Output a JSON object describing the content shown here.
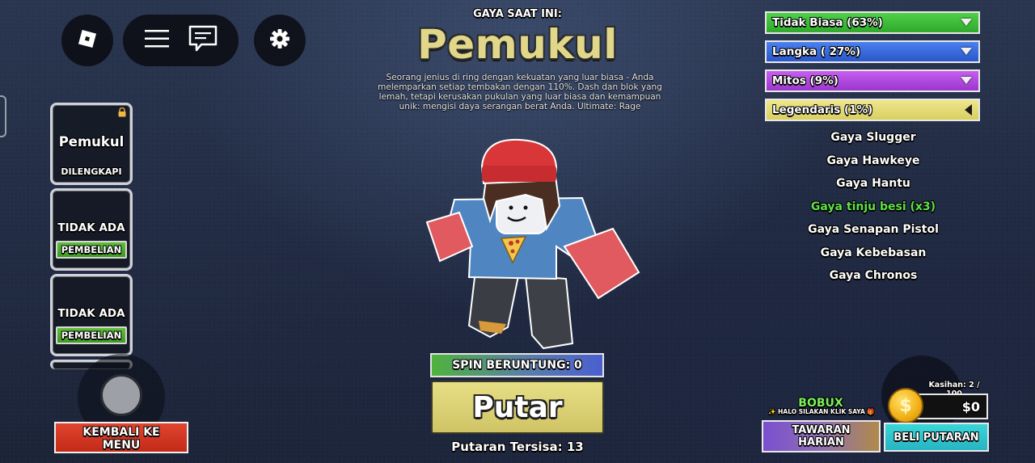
{
  "topbar": {
    "roblox_icon": "roblox-logo-icon",
    "menu_icon": "hamburger-icon",
    "chat_icon": "chat-icon",
    "settings_icon": "gear-icon"
  },
  "header": {
    "label": "GAYA SAAT INI:",
    "style_name": "Pemukul",
    "description": "Seorang jenius di ring dengan kekuatan yang luar biasa - Anda melemparkan setiap tembakan dengan 110%. Dash dan blok yang lemah, tetapi kerusakan pukulan yang luar biasa dan kemampuan unik: mengisi daya serangan berat Anda. Ultimate: Rage"
  },
  "slots": [
    {
      "name": "Pemukul",
      "tag": "DILENGKAPI"
    },
    {
      "name": "TIDAK ADA",
      "tag": "PEMBELIAN"
    },
    {
      "name": "TIDAK ADA",
      "tag": "PEMBELIAN"
    }
  ],
  "back_button": {
    "line1": "KEMBALI KE",
    "line2": "MENU"
  },
  "spin": {
    "lucky_label": "SPIN BERUNTUNG: 0",
    "button_label": "Putar",
    "remaining_label": "Putaran Tersisa: 13"
  },
  "rarities": [
    {
      "label": "Tidak Biasa (63%)",
      "color": "#3fbf3a",
      "state": "collapsed"
    },
    {
      "label": "Langka ( 27%)",
      "color": "#3a6fe0",
      "state": "collapsed"
    },
    {
      "label": "Mitos (9%)",
      "color": "#b64fe0",
      "state": "collapsed"
    },
    {
      "label": "Legendaris (1%)",
      "color": "#e6df7a",
      "state": "expanded"
    }
  ],
  "styles": [
    {
      "label": "Gaya Slugger",
      "color": "#ffffff"
    },
    {
      "label": "Gaya Hawkeye",
      "color": "#ffffff"
    },
    {
      "label": "Gaya Hantu",
      "color": "#ffffff"
    },
    {
      "label": "Gaya tinju besi (x3)",
      "color": "#5fe04a"
    },
    {
      "label": "Gaya Senapan Pistol",
      "color": "#ffffff"
    },
    {
      "label": "Gaya Kebebasan",
      "color": "#ffffff"
    },
    {
      "label": "Gaya Chronos",
      "color": "#ffffff"
    }
  ],
  "shop": {
    "bobux_title": "BOBUX",
    "bobux_sub": "✨ HALO SILAKAN KLIK SAYA 🎁",
    "kasihan": "Kasihan: 2 / 100",
    "money": "$0",
    "coin_symbol": "$",
    "daily_line1": "TAWARAN",
    "daily_line2": "HARIAN",
    "buy_label": "BELI PUTARAN"
  }
}
